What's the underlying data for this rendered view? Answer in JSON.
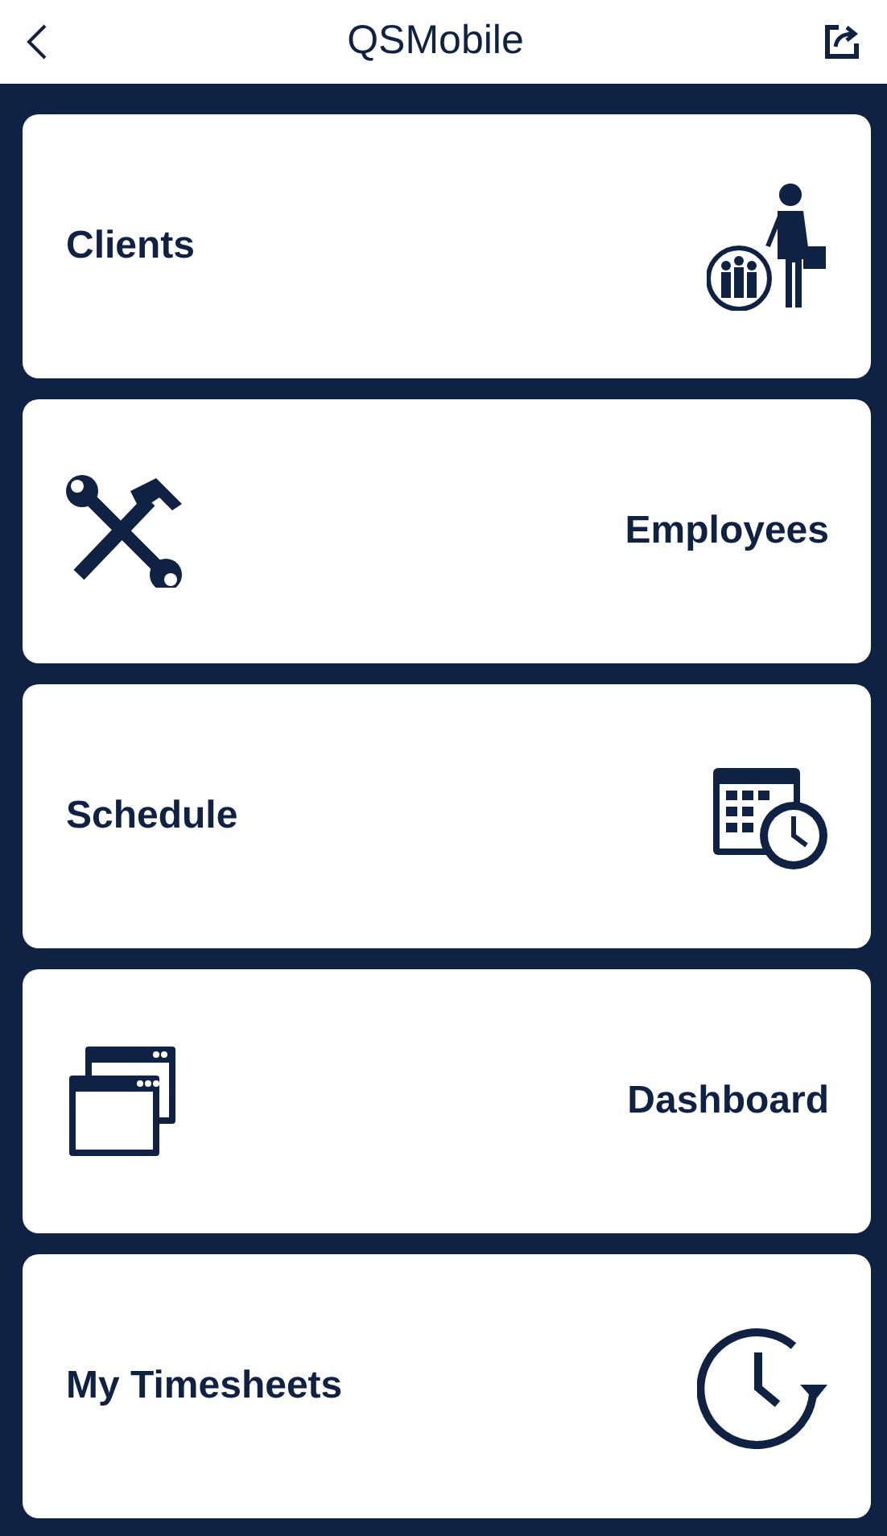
{
  "header": {
    "title": "QSMobile"
  },
  "menu": [
    {
      "label": "Clients",
      "kind": "people",
      "icon_left": false
    },
    {
      "label": "Employees",
      "kind": "tools",
      "icon_left": true
    },
    {
      "label": "Schedule",
      "kind": "calendar",
      "icon_left": false
    },
    {
      "label": "Dashboard",
      "kind": "windows",
      "icon_left": true
    },
    {
      "label": "My Timesheets",
      "kind": "clock",
      "icon_left": false
    }
  ]
}
